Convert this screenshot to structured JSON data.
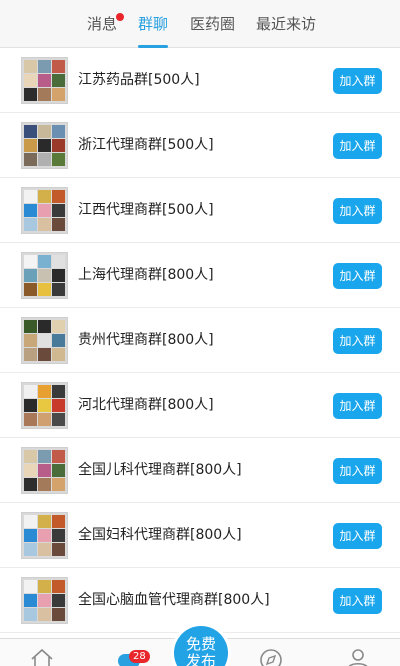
{
  "tabs": [
    {
      "label": "消息",
      "has_dot": true
    },
    {
      "label": "群聊",
      "active": true
    },
    {
      "label": "医药圈"
    },
    {
      "label": "最近来访"
    }
  ],
  "groups": [
    {
      "name": "江苏药品群[500人]",
      "button": "加入群",
      "tiles": [
        "#d8c8a8",
        "#7a9bb0",
        "#c25a4a",
        "#e9d6b8",
        "#b85c8a",
        "#4a6b3a",
        "#2d2d2d",
        "#a37b5a",
        "#d4a36c"
      ]
    },
    {
      "name": "浙江代理商群[500人]",
      "button": "加入群",
      "tiles": [
        "#3a4f7a",
        "#c8b89a",
        "#6a8fb0",
        "#c89a4a",
        "#2a2a2a",
        "#9a3a2a",
        "#7a6a5a",
        "#b0b0b0",
        "#5a7a3a"
      ]
    },
    {
      "name": "江西代理商群[500人]",
      "button": "加入群",
      "tiles": [
        "#f2f2f2",
        "#d4b04a",
        "#c25a2a",
        "#2a8ad4",
        "#e8a0b0",
        "#3a3a3a",
        "#a8c8e0",
        "#d8c0a0",
        "#6a4a3a"
      ]
    },
    {
      "name": "上海代理商群[800人]",
      "button": "加入群",
      "tiles": [
        "#f4f4f4",
        "#7ab0d0",
        "#e0e0e0",
        "#6aa0b8",
        "#c8c0b0",
        "#2a2a2a",
        "#8a5a2a",
        "#e8c040",
        "#3a3a3a"
      ]
    },
    {
      "name": "贵州代理商群[800人]",
      "button": "加入群",
      "tiles": [
        "#3a5a2a",
        "#2a2a2a",
        "#e0d0b0",
        "#c8a878",
        "#e0e0e0",
        "#4a7a9a",
        "#b8a080",
        "#6a4a3a",
        "#d0b890"
      ]
    },
    {
      "name": "河北代理商群[800人]",
      "button": "加入群",
      "tiles": [
        "#f0f0f0",
        "#e8a030",
        "#3a3a3a",
        "#2a2a2a",
        "#e8c840",
        "#c83a2a",
        "#a87858",
        "#d0a070",
        "#4a4a4a"
      ]
    },
    {
      "name": "全国儿科代理商群[800人]",
      "button": "加入群",
      "tiles": [
        "#d8c8a8",
        "#7a9bb0",
        "#c25a4a",
        "#e9d6b8",
        "#b85c8a",
        "#4a6b3a",
        "#2d2d2d",
        "#a37b5a",
        "#d4a36c"
      ]
    },
    {
      "name": "全国妇科代理商群[800人]",
      "button": "加入群",
      "tiles": [
        "#f2f2f2",
        "#d4b04a",
        "#c25a2a",
        "#2a8ad4",
        "#e8a0b0",
        "#3a3a3a",
        "#a8c8e0",
        "#d8c0a0",
        "#6a4a3a"
      ]
    },
    {
      "name": "全国心脑血管代理商群[800人]",
      "button": "加入群",
      "tiles": [
        "#f2f2f2",
        "#d4b04a",
        "#c25a2a",
        "#2a8ad4",
        "#e8a0b0",
        "#3a3a3a",
        "#a8c8e0",
        "#d8c0a0",
        "#6a4a3a"
      ]
    }
  ],
  "bottom_nav": {
    "badge_count": "28",
    "fab_line1": "免费",
    "fab_line2": "发布",
    "icons": [
      "home-icon",
      "chat-icon",
      "compass-icon",
      "user-icon"
    ]
  },
  "colors": {
    "accent": "#29a0e0",
    "button": "#1aa6ec",
    "badge": "#e8262c"
  }
}
